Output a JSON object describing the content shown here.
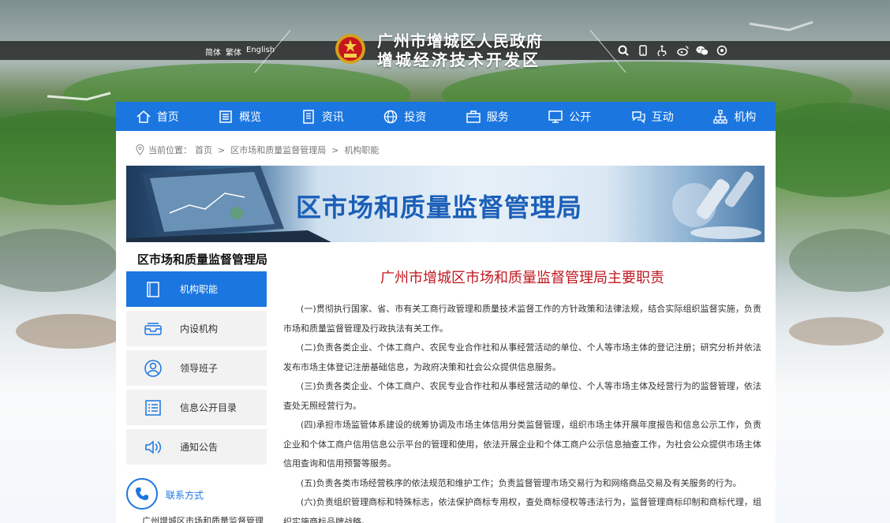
{
  "header": {
    "languages": [
      "简体",
      "繁体",
      "English"
    ],
    "title_line1": "广州市增城区人民政府",
    "title_line2": "增城经济技术开发区",
    "tools": [
      "search-icon",
      "mobile-icon",
      "accessibility-icon",
      "weibo-icon",
      "wechat-icon",
      "settings-icon"
    ]
  },
  "nav": [
    {
      "label": "首页",
      "icon": "home-icon"
    },
    {
      "label": "概览",
      "icon": "overview-icon"
    },
    {
      "label": "资讯",
      "icon": "news-icon"
    },
    {
      "label": "投资",
      "icon": "globe-icon"
    },
    {
      "label": "服务",
      "icon": "briefcase-icon"
    },
    {
      "label": "公开",
      "icon": "monitor-icon"
    },
    {
      "label": "互动",
      "icon": "chat-icon"
    },
    {
      "label": "机构",
      "icon": "org-icon"
    }
  ],
  "breadcrumb": {
    "prefix": "当前位置：",
    "items": [
      "首页",
      "区市场和质量监督管理局",
      "机构职能"
    ],
    "separator": ">"
  },
  "banner": {
    "title": "区市场和质量监督管理局"
  },
  "sidebar": {
    "title": "区市场和质量监督管理局",
    "items": [
      {
        "label": "机构职能",
        "icon": "document-icon",
        "active": true
      },
      {
        "label": "内设机构",
        "icon": "inbox-icon",
        "active": false
      },
      {
        "label": "领导班子",
        "icon": "user-icon",
        "active": false
      },
      {
        "label": "信息公开目录",
        "icon": "list-icon",
        "active": false
      },
      {
        "label": "通知公告",
        "icon": "speaker-icon",
        "active": false
      }
    ],
    "contact_label": "联系方式",
    "contact_org": "广州增城区市场和质量监督管理"
  },
  "article": {
    "title": "广州市增城区市场和质量监督管理局主要职责",
    "paragraphs": [
      "(一)贯彻执行国家、省、市有关工商行政管理和质量技术监督工作的方针政策和法律法规，结合实际组织监督实施，负责市场和质量监督管理及行政执法有关工作。",
      "(二)负责各类企业、个体工商户、农民专业合作社和从事经营活动的单位、个人等市场主体的登记注册；研究分析并依法发布市场主体登记注册基础信息，为政府决策和社会公众提供信息服务。",
      "(三)负责各类企业、个体工商户、农民专业合作社和从事经营活动的单位、个人等市场主体及经营行为的监督管理，依法查处无照经营行为。",
      "(四)承担市场监管体系建设的统筹协调及市场主体信用分类监督管理，组织市场主体开展年度报告和信息公示工作，负责企业和个体工商户信用信息公示平台的管理和使用，依法开展企业和个体工商户公示信息抽查工作，为社会公众提供市场主体信用查询和信用预警等服务。",
      "(五)负责各类市场经营秩序的依法规范和维护工作；负责监督管理市场交易行为和网络商品交易及有关服务的行为。",
      "(六)负责组织管理商标和特殊标志，依法保护商标专用权，查处商标侵权等违法行为，监督管理商标印制和商标代理，组织实施商标品牌战略。"
    ]
  },
  "colors": {
    "accent": "#1b76e0",
    "title_red": "#c0171f"
  }
}
